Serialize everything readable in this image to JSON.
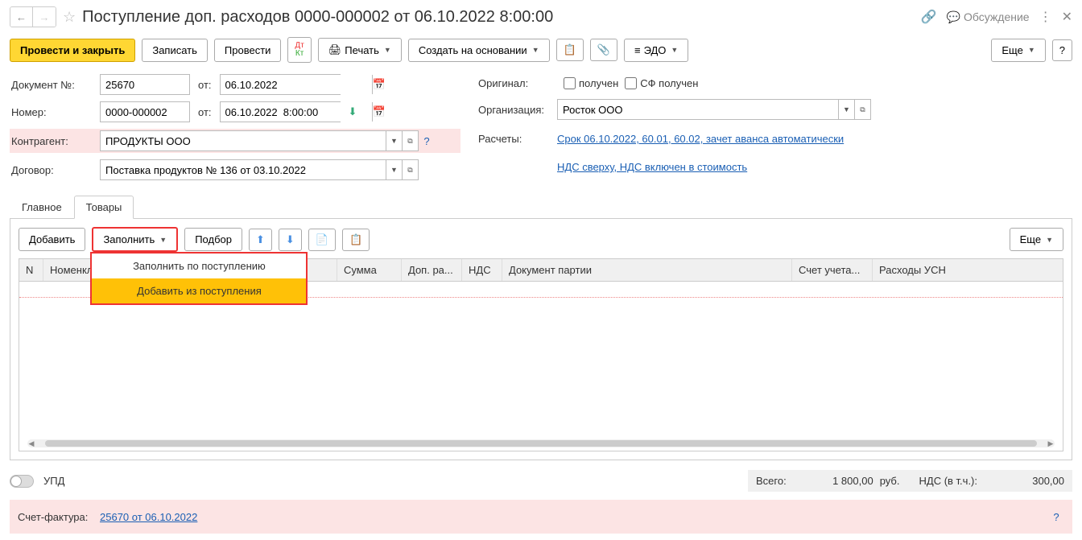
{
  "title": "Поступление доп. расходов 0000-000002 от 06.10.2022 8:00:00",
  "discuss": "Обсуждение",
  "toolbar": {
    "post_close": "Провести и закрыть",
    "save": "Записать",
    "post": "Провести",
    "print": "Печать",
    "create_based": "Создать на основании",
    "edo": "ЭДО",
    "more": "Еще",
    "help": "?"
  },
  "form": {
    "doc_num_label": "Документ №:",
    "doc_num": "25670",
    "from_label": "от:",
    "doc_date": "06.10.2022",
    "number_label": "Номер:",
    "number": "0000-000002",
    "number_date": "06.10.2022  8:00:00",
    "contractor_label": "Контрагент:",
    "contractor": "ПРОДУКТЫ ООО",
    "contract_label": "Договор:",
    "contract": "Поставка продуктов № 136 от 03.10.2022",
    "original_label": "Оригинал:",
    "received": "получен",
    "sf_received": "СФ получен",
    "org_label": "Организация:",
    "org": "Росток ООО",
    "calc_label": "Расчеты:",
    "calc_link": "Срок 06.10.2022, 60.01, 60.02, зачет аванса автоматически",
    "vat_link": "НДС сверху, НДС включен в стоимость"
  },
  "tabs": {
    "main": "Главное",
    "goods": "Товары"
  },
  "tab_toolbar": {
    "add": "Добавить",
    "fill": "Заполнить",
    "select": "Подбор",
    "more": "Еще"
  },
  "fill_menu": {
    "by_receipt": "Заполнить по поступлению",
    "add_from_receipt": "Добавить из поступления"
  },
  "columns": {
    "n": "N",
    "nomenclature": "Номенкла...",
    "sum": "Сумма",
    "add_exp": "Доп. ра...",
    "vat": "НДС",
    "batch_doc": "Документ партии",
    "account": "Счет учета...",
    "usn_exp": "Расходы УСН"
  },
  "totals": {
    "upd": "УПД",
    "total_label": "Всего:",
    "total_val": "1 800,00",
    "currency": "руб.",
    "vat_label": "НДС (в т.ч.):",
    "vat_val": "300,00"
  },
  "invoice": {
    "label": "Счет-фактура:",
    "link": "25670 от 06.10.2022",
    "help": "?"
  }
}
